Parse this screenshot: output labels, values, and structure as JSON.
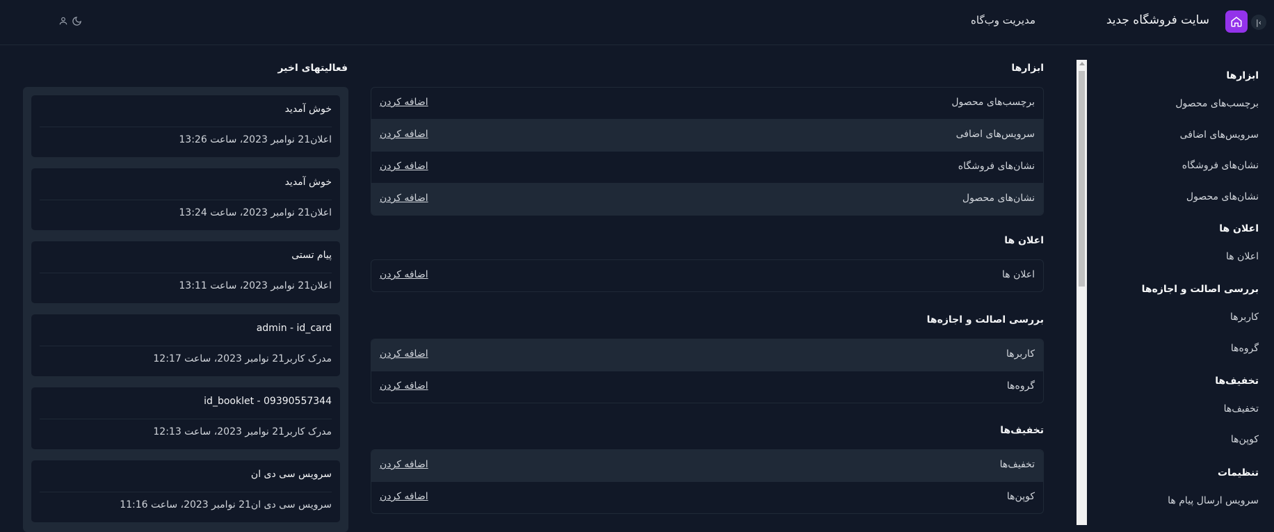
{
  "header": {
    "site_title": "سایت فروشگاه جدید",
    "admin_title": "مدیریت وب‌گاه",
    "accent_color": "#9333ea",
    "icons": [
      "collapse-icon",
      "home-icon",
      "moon-icon",
      "user-icon"
    ]
  },
  "sidebar": {
    "sections": [
      {
        "title": "ابزارها",
        "items": [
          "برچسب‌های محصول",
          "سرویس‌های اضافی",
          "نشان‌های فروشگاه",
          "نشان‌های محصول"
        ]
      },
      {
        "title": "اعلان ها",
        "items": [
          "اعلان ها"
        ]
      },
      {
        "title": "بررسی اصالت و اجازه‌ها",
        "items": [
          "کاربرها",
          "گروه‌ها"
        ]
      },
      {
        "title": "تخفیف‌ها",
        "items": [
          "تخفیف‌ها",
          "کوپن‌ها"
        ]
      },
      {
        "title": "تنظیمات",
        "items": [
          "سرویس ارسال پیام ها"
        ]
      }
    ]
  },
  "main": {
    "add_label": "اضافه کردن",
    "groups": [
      {
        "title": "ابزارها",
        "rows": [
          "برچسب‌های محصول",
          "سرویس‌های اضافی",
          "نشان‌های فروشگاه",
          "نشان‌های محصول"
        ]
      },
      {
        "title": "اعلان ها",
        "rows": [
          "اعلان ها"
        ]
      },
      {
        "title": "بررسی اصالت و اجازه‌ها",
        "rows": [
          "کاربرها",
          "گروه‌ها"
        ]
      },
      {
        "title": "تخفیف‌ها",
        "rows": [
          "تخفیف‌ها",
          "کوپن‌ها"
        ]
      }
    ]
  },
  "activity": {
    "title": "فعالیتهای اخیر",
    "items": [
      {
        "title": "خوش آمدید",
        "meta": "اعلان21 نوامبر 2023، ساعت 13:26"
      },
      {
        "title": "خوش آمدید",
        "meta": "اعلان21 نوامبر 2023، ساعت 13:24"
      },
      {
        "title": "پیام تستی",
        "meta": "اعلان21 نوامبر 2023، ساعت 13:11"
      },
      {
        "title": "admin - id_card",
        "meta": "مدرک کاربر21 نوامبر 2023، ساعت 12:17"
      },
      {
        "title": "id_booklet - 09390557344",
        "meta": "مدرک کاربر21 نوامبر 2023، ساعت 12:13"
      },
      {
        "title": "سرویس سی دی ان",
        "meta": "سرویس سی دی ان21 نوامبر 2023، ساعت 11:16"
      }
    ]
  }
}
